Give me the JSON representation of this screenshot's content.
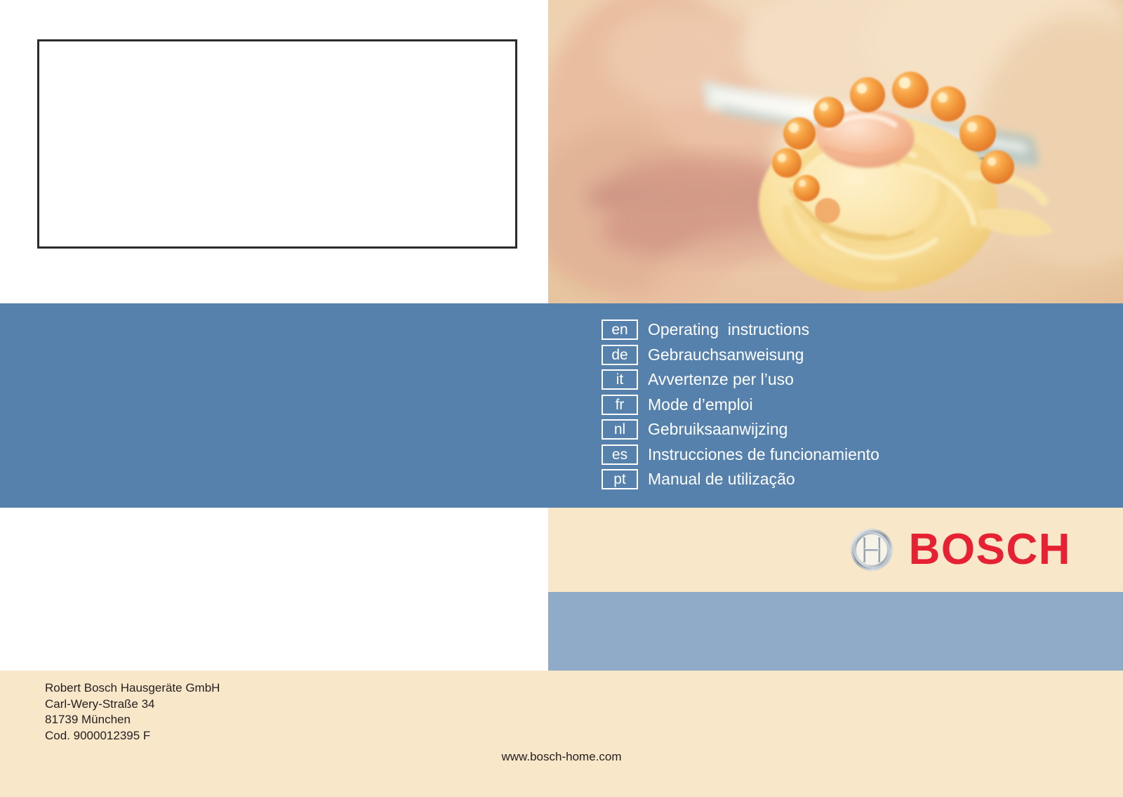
{
  "document": {
    "kind": "appliance-manual-cover",
    "brand": "BOSCH"
  },
  "spec_box": {
    "content": ""
  },
  "cover_photo": {
    "alt": "Close-up of a person eating spaghetti with salmon and salmon roe from a fork",
    "icon": "pasta-fork-photo"
  },
  "languages": {
    "items": [
      {
        "code": "en",
        "label": "Operating  instructions"
      },
      {
        "code": "de",
        "label": "Gebrauchsanweisung"
      },
      {
        "code": "it",
        "label": "Avvertenze per l’uso"
      },
      {
        "code": "fr",
        "label": "Mode d’emploi"
      },
      {
        "code": "nl",
        "label": "Gebruiksaanwijzing"
      },
      {
        "code": "es",
        "label": "Instrucciones de funcionamiento"
      },
      {
        "code": "pt",
        "label": "Manual de utilização"
      }
    ]
  },
  "logo": {
    "wordmark": "BOSCH",
    "symbol": "bosch-armature-icon"
  },
  "footer": {
    "address": {
      "line1": "Robert Bosch Hausgeräte GmbH",
      "line2": "Carl-Wery-Straße 34",
      "line3": "81739 München",
      "line4": "Cod. 9000012395 F"
    },
    "website": "www.bosch-home.com"
  },
  "colors": {
    "banner_blue": "#5581ac",
    "light_blue": "#8fabc7",
    "cream": "#f9e7c9",
    "bosch_red": "#e52133",
    "text": "#231f20",
    "box_border": "#2b2b2b"
  }
}
